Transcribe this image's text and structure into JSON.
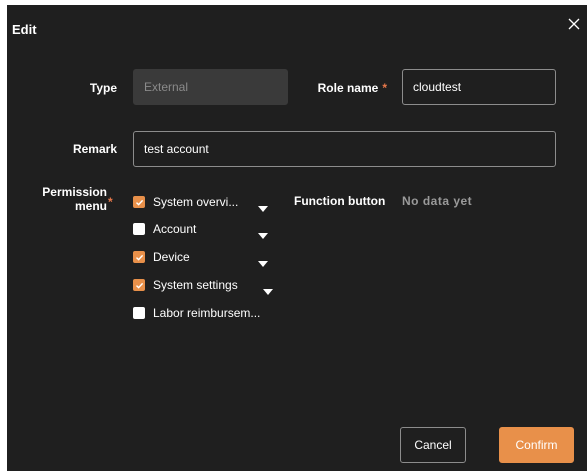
{
  "dialog": {
    "title": "Edit",
    "close_icon": "close-icon"
  },
  "form": {
    "type_label": "Type",
    "type_value": "External",
    "role_name_label": "Role name",
    "role_name_value": "cloudtest",
    "required_mark": "*",
    "remark_label": "Remark",
    "remark_value": "test account",
    "permission_label_line1": "Permission",
    "permission_label_line2": "menu",
    "function_button_label": "Function button",
    "function_button_empty": "No data yet"
  },
  "permissions": [
    {
      "label": "System overvi...",
      "checked": true,
      "expandable": true
    },
    {
      "label": "Account",
      "checked": false,
      "expandable": true
    },
    {
      "label": "Device",
      "checked": true,
      "expandable": true
    },
    {
      "label": "System settings",
      "checked": true,
      "expandable": true
    },
    {
      "label": "Labor reimbursem...",
      "checked": false,
      "expandable": false
    }
  ],
  "buttons": {
    "cancel": "Cancel",
    "confirm": "Confirm"
  },
  "colors": {
    "accent": "#e8904a",
    "background": "#1f1f1f",
    "required": "#e8784a"
  }
}
